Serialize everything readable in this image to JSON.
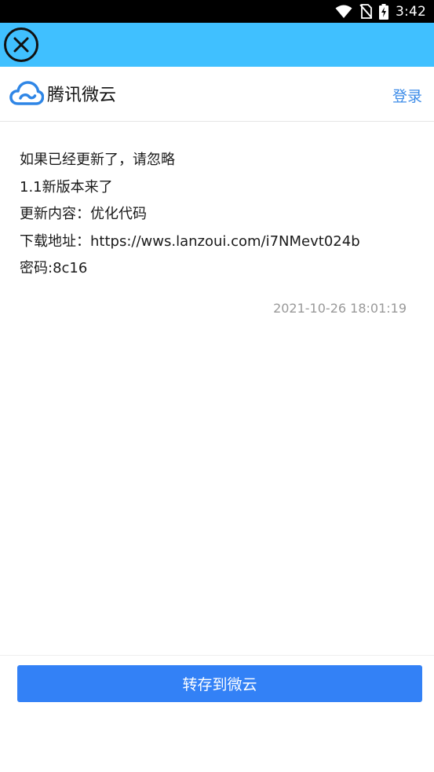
{
  "status_bar": {
    "time": "3:42",
    "icons": [
      "wifi-icon",
      "no-sim-icon",
      "battery-charging-icon"
    ]
  },
  "top_bar": {
    "close_icon": "close-circle-icon",
    "color": "#40c0ff"
  },
  "header": {
    "logo_text": "腾讯微云",
    "login_label": "登录",
    "accent": "#3d8ce8"
  },
  "message": {
    "lines": [
      "如果已经更新了，请忽略",
      "1.1新版本来了",
      "更新内容：优化代码",
      "下载地址：https://wws.lanzoui.com/i7NMevt024b",
      "密码:8c16"
    ],
    "timestamp": "2021-10-26 18:01:19"
  },
  "footer": {
    "save_button_label": "转存到微云",
    "button_color": "#3381f6"
  }
}
